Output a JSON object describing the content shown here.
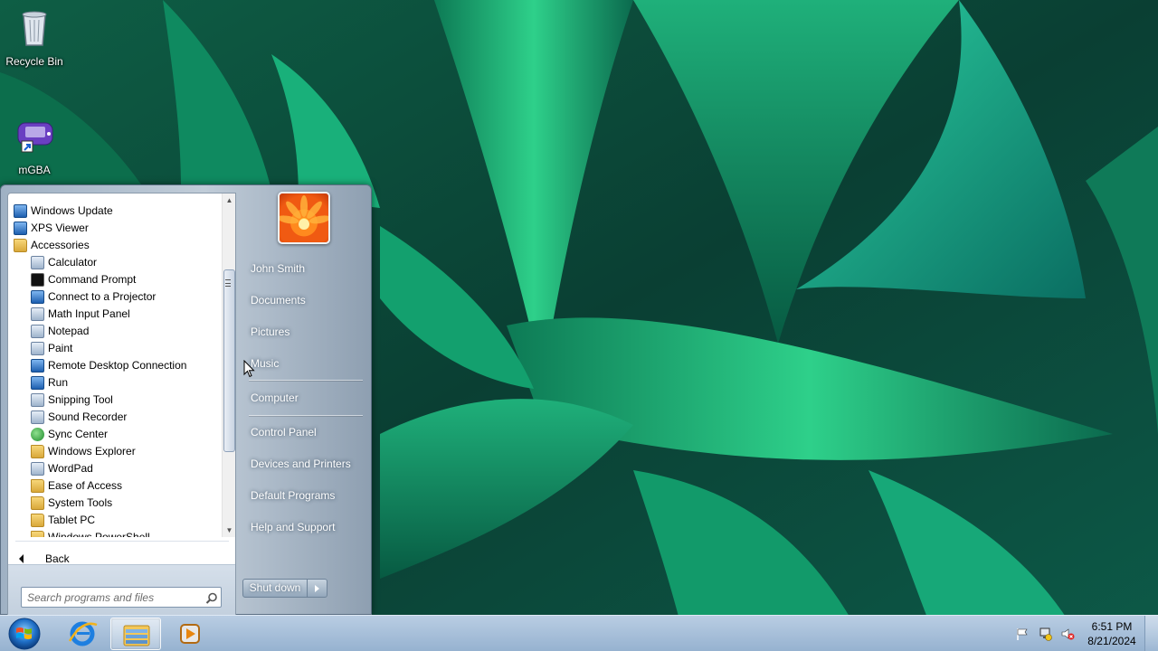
{
  "desktop": {
    "icons": [
      {
        "label": "Recycle Bin",
        "icon": "recycle-bin-icon"
      },
      {
        "label": "mGBA",
        "icon": "mgba-icon"
      }
    ]
  },
  "start_menu": {
    "programs": [
      {
        "label": "Windows Update",
        "icon": "windows-update-icon",
        "level": 0
      },
      {
        "label": "XPS Viewer",
        "icon": "xps-viewer-icon",
        "level": 0
      },
      {
        "label": "Accessories",
        "icon": "folder-icon",
        "level": 0
      },
      {
        "label": "Calculator",
        "icon": "calculator-icon",
        "level": 1
      },
      {
        "label": "Command Prompt",
        "icon": "command-prompt-icon",
        "level": 1
      },
      {
        "label": "Connect to a Projector",
        "icon": "projector-icon",
        "level": 1
      },
      {
        "label": "Math Input Panel",
        "icon": "math-input-icon",
        "level": 1
      },
      {
        "label": "Notepad",
        "icon": "notepad-icon",
        "level": 1
      },
      {
        "label": "Paint",
        "icon": "paint-icon",
        "level": 1
      },
      {
        "label": "Remote Desktop Connection",
        "icon": "remote-desktop-icon",
        "level": 1
      },
      {
        "label": "Run",
        "icon": "run-icon",
        "level": 1
      },
      {
        "label": "Snipping Tool",
        "icon": "snipping-tool-icon",
        "level": 1
      },
      {
        "label": "Sound Recorder",
        "icon": "microphone-icon",
        "level": 1
      },
      {
        "label": "Sync Center",
        "icon": "sync-center-icon",
        "level": 1
      },
      {
        "label": "Windows Explorer",
        "icon": "folder-explorer-icon",
        "level": 1
      },
      {
        "label": "WordPad",
        "icon": "wordpad-icon",
        "level": 1
      },
      {
        "label": "Ease of Access",
        "icon": "folder-icon",
        "level": 1
      },
      {
        "label": "System Tools",
        "icon": "folder-icon",
        "level": 1
      },
      {
        "label": "Tablet PC",
        "icon": "folder-icon",
        "level": 1
      },
      {
        "label": "Windows PowerShell",
        "icon": "folder-icon",
        "level": 1
      }
    ],
    "back_label": "Back",
    "search_placeholder": "Search programs and files",
    "right_pane": {
      "items": [
        "John Smith",
        "Documents",
        "Pictures",
        "Music",
        "Computer",
        "Control Panel",
        "Devices and Printers",
        "Default Programs",
        "Help and Support"
      ]
    },
    "shutdown_label": "Shut down"
  },
  "taskbar": {
    "pinned": [
      "internet-explorer-icon",
      "windows-explorer-icon",
      "media-player-icon"
    ],
    "tray_icons": [
      "action-center-flag-icon",
      "network-icon",
      "volume-muted-icon"
    ],
    "clock": {
      "time": "6:51 PM",
      "date": "8/21/2024"
    }
  },
  "colors": {
    "taskbar": "#a9c0da",
    "start_menu_right": "#aebdcc",
    "wallpaper_green": "#1a9a6a"
  }
}
